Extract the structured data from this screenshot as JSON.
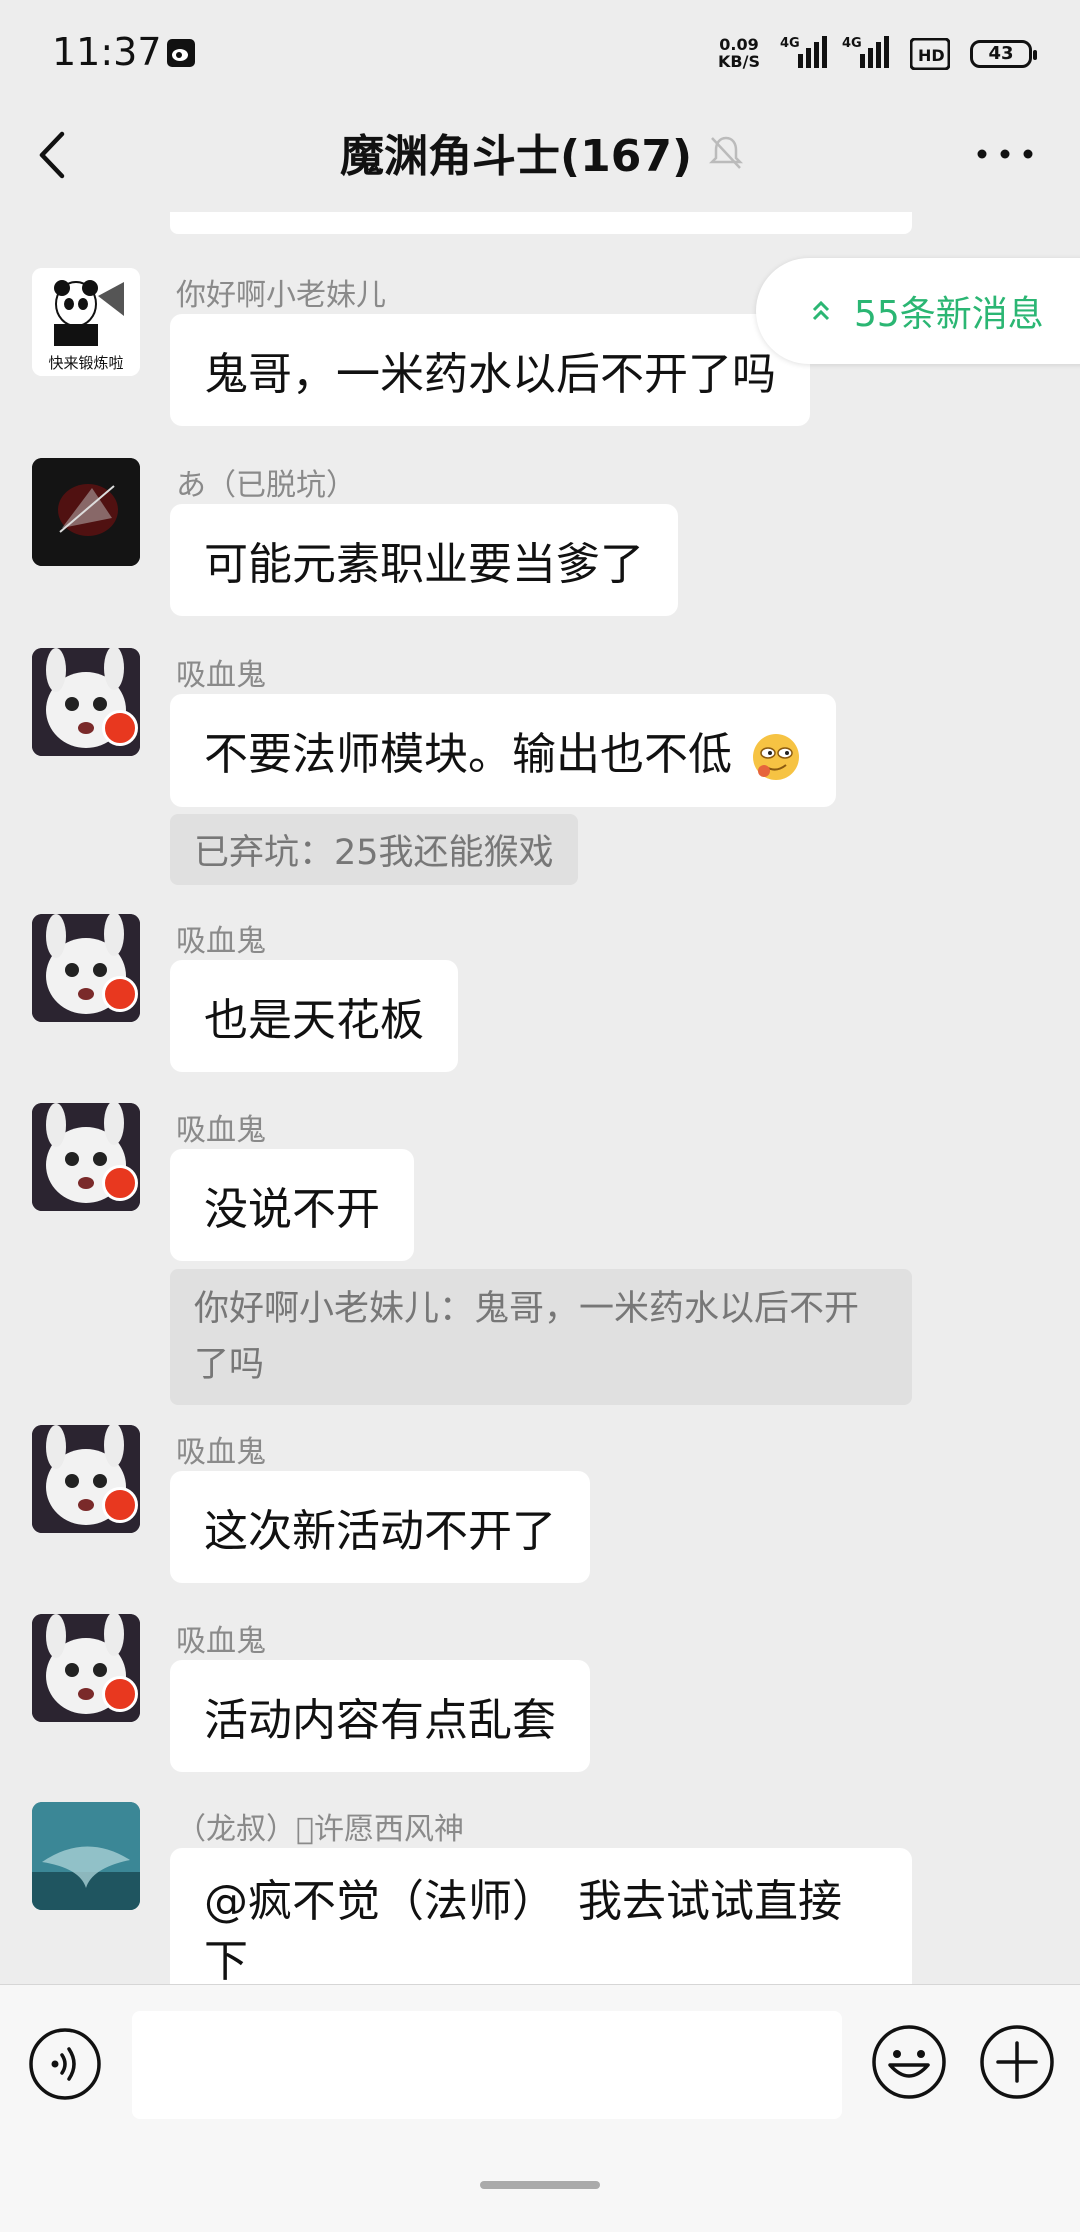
{
  "status_bar": {
    "time": "11:37",
    "net_speed_value": "0.09",
    "net_speed_unit": "KB/S",
    "signal1_label": "4G",
    "signal2_label": "4G",
    "battery": "43"
  },
  "header": {
    "title": "魔渊角斗士(167)"
  },
  "new_messages_pill": "55条新消息",
  "messages": [
    {
      "sender": "你好啊小老妹儿",
      "text": "鬼哥，一米药水以后不开了吗",
      "avatar_caption": "快来锻炼啦"
    },
    {
      "sender": "あ（已脱坑）",
      "text": "可能元素职业要当爹了"
    },
    {
      "sender": "吸血鬼",
      "text": "不要法师模块。输出也不低",
      "quote": "已弃坑：25我还能猴戏"
    },
    {
      "sender": "吸血鬼",
      "text": "也是天花板"
    },
    {
      "sender": "吸血鬼",
      "text": "没说不开",
      "quote": "你好啊小老妹儿：鬼哥，一米药水以后不开了吗"
    },
    {
      "sender": "吸血鬼",
      "text": "这次新活动不开了"
    },
    {
      "sender": "吸血鬼",
      "text": "活动内容有点乱套"
    },
    {
      "sender": "（龙叔）\u0000许愿西风神",
      "text": "@疯不觉（法师）　我去试试直接下"
    }
  ],
  "input": {
    "placeholder": ""
  },
  "colors": {
    "background": "#ededed",
    "bubble": "#ffffff",
    "accent_green": "#2bb673",
    "sender_gray": "#8a8a8a"
  }
}
